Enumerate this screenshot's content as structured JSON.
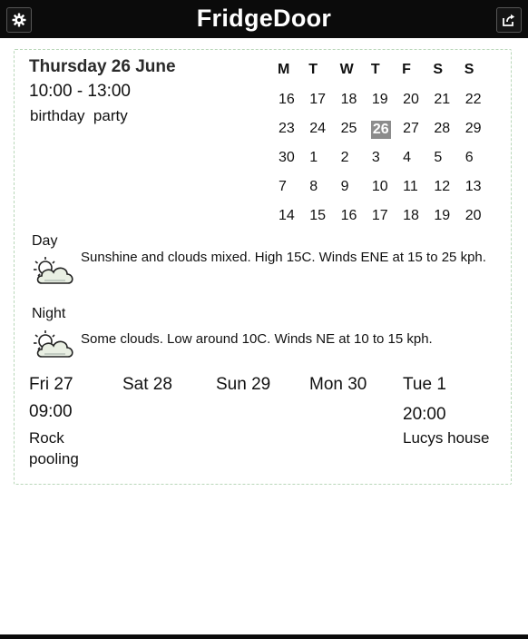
{
  "header": {
    "title": "FridgeDoor"
  },
  "event": {
    "date": "Thursday 26 June",
    "time": "10:00 - 13:00",
    "title": "birthday  party"
  },
  "calendar": {
    "weekdays": [
      "M",
      "T",
      "W",
      "T",
      "F",
      "S",
      "S"
    ],
    "weeks": [
      [
        "16",
        "17",
        "18",
        "19",
        "20",
        "21",
        "22"
      ],
      [
        "23",
        "24",
        "25",
        "26",
        "27",
        "28",
        "29"
      ],
      [
        "30",
        "1",
        "2",
        "3",
        "4",
        "5",
        "6"
      ],
      [
        "7",
        "8",
        "9",
        "10",
        "11",
        "12",
        "13"
      ],
      [
        "14",
        "15",
        "16",
        "17",
        "18",
        "19",
        "20"
      ]
    ],
    "today": "26"
  },
  "weather": {
    "day": {
      "label": "Day",
      "icon": "partly-cloudy-icon",
      "text": "Sunshine and clouds mixed. High 15C. Winds ENE at 15 to 25 kph."
    },
    "night": {
      "label": "Night",
      "icon": "partly-cloudy-icon",
      "text": "Some clouds. Low around 10C. Winds NE at 10 to 15 kph."
    }
  },
  "upcoming": [
    {
      "day": "Fri 27",
      "time": "09:00",
      "event": "Rock pooling"
    },
    {
      "day": "Sat 28",
      "time": "",
      "event": ""
    },
    {
      "day": "Sun 29",
      "time": "",
      "event": ""
    },
    {
      "day": "Mon 30",
      "time": "",
      "event": ""
    },
    {
      "day": "Tue 1",
      "time": "20:00",
      "event": "Lucys house"
    }
  ],
  "icons": {
    "settings": "gear-icon",
    "share": "share-icon"
  }
}
